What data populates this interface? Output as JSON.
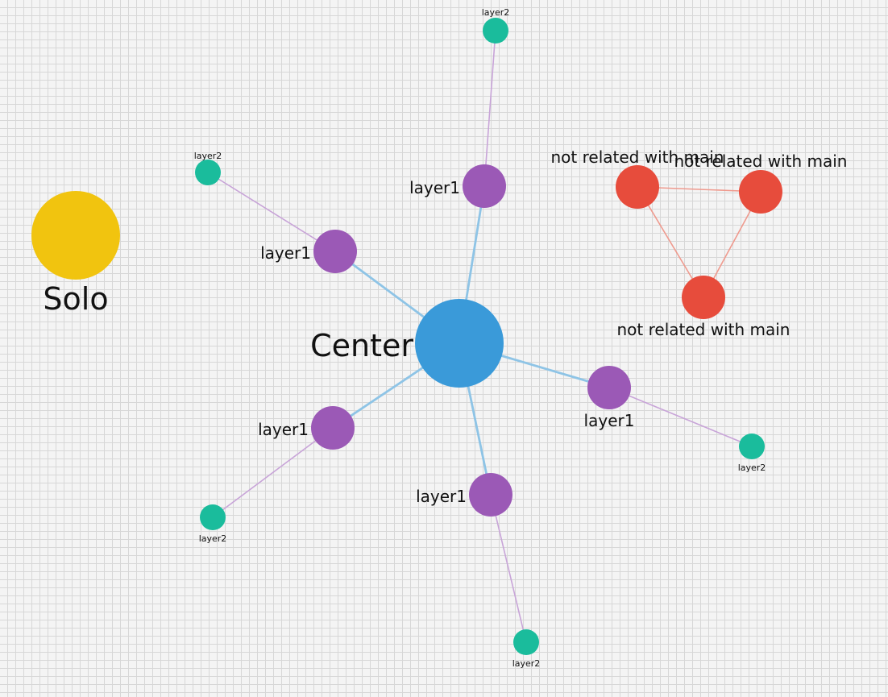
{
  "graph": {
    "colors": {
      "center": "#3a9ad9",
      "layer1": "#9b59b6",
      "layer2": "#1abc9c",
      "unrelated": "#e74c3c",
      "solo": "#f1c40f",
      "edge_center": "#8ec4e6",
      "edge_layer1": "#c8a4d8",
      "edge_unrelated": "#ef9a8e"
    },
    "nodes": [
      {
        "id": "solo",
        "label": "Solo",
        "group": "solo"
      },
      {
        "id": "center",
        "label": "Center",
        "group": "center"
      },
      {
        "id": "l1_top",
        "label": "layer1",
        "group": "layer1"
      },
      {
        "id": "l1_upleft",
        "label": "layer1",
        "group": "layer1"
      },
      {
        "id": "l1_right",
        "label": "layer1",
        "group": "layer1"
      },
      {
        "id": "l1_lowleft",
        "label": "layer1",
        "group": "layer1"
      },
      {
        "id": "l1_bottom",
        "label": "layer1",
        "group": "layer1"
      },
      {
        "id": "l2_top",
        "label": "layer2",
        "group": "layer2"
      },
      {
        "id": "l2_upleft",
        "label": "layer2",
        "group": "layer2"
      },
      {
        "id": "l2_right",
        "label": "layer2",
        "group": "layer2"
      },
      {
        "id": "l2_lowleft",
        "label": "layer2",
        "group": "layer2"
      },
      {
        "id": "l2_bottom",
        "label": "layer2",
        "group": "layer2"
      },
      {
        "id": "u1",
        "label": "not related with main",
        "group": "unrelated"
      },
      {
        "id": "u2",
        "label": "not related with main",
        "group": "unrelated"
      },
      {
        "id": "u3",
        "label": "not related with main",
        "group": "unrelated"
      }
    ],
    "edges": [
      {
        "from": "center",
        "to": "l1_top"
      },
      {
        "from": "center",
        "to": "l1_upleft"
      },
      {
        "from": "center",
        "to": "l1_right"
      },
      {
        "from": "center",
        "to": "l1_lowleft"
      },
      {
        "from": "center",
        "to": "l1_bottom"
      },
      {
        "from": "l1_top",
        "to": "l2_top"
      },
      {
        "from": "l1_upleft",
        "to": "l2_upleft"
      },
      {
        "from": "l1_right",
        "to": "l2_right"
      },
      {
        "from": "l1_lowleft",
        "to": "l2_lowleft"
      },
      {
        "from": "l1_bottom",
        "to": "l2_bottom"
      },
      {
        "from": "u1",
        "to": "u2"
      },
      {
        "from": "u1",
        "to": "u3"
      },
      {
        "from": "u2",
        "to": "u3"
      }
    ]
  }
}
